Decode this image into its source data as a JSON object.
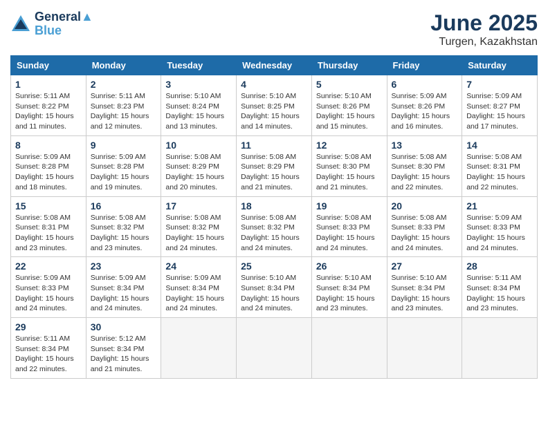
{
  "logo": {
    "line1": "General",
    "line2": "Blue"
  },
  "title": "June 2025",
  "location": "Turgen, Kazakhstan",
  "weekdays": [
    "Sunday",
    "Monday",
    "Tuesday",
    "Wednesday",
    "Thursday",
    "Friday",
    "Saturday"
  ],
  "weeks": [
    [
      {
        "day": 1,
        "sunrise": "5:11 AM",
        "sunset": "8:22 PM",
        "daylight": "15 hours and 11 minutes."
      },
      {
        "day": 2,
        "sunrise": "5:11 AM",
        "sunset": "8:23 PM",
        "daylight": "15 hours and 12 minutes."
      },
      {
        "day": 3,
        "sunrise": "5:10 AM",
        "sunset": "8:24 PM",
        "daylight": "15 hours and 13 minutes."
      },
      {
        "day": 4,
        "sunrise": "5:10 AM",
        "sunset": "8:25 PM",
        "daylight": "15 hours and 14 minutes."
      },
      {
        "day": 5,
        "sunrise": "5:10 AM",
        "sunset": "8:26 PM",
        "daylight": "15 hours and 15 minutes."
      },
      {
        "day": 6,
        "sunrise": "5:09 AM",
        "sunset": "8:26 PM",
        "daylight": "15 hours and 16 minutes."
      },
      {
        "day": 7,
        "sunrise": "5:09 AM",
        "sunset": "8:27 PM",
        "daylight": "15 hours and 17 minutes."
      }
    ],
    [
      {
        "day": 8,
        "sunrise": "5:09 AM",
        "sunset": "8:28 PM",
        "daylight": "15 hours and 18 minutes."
      },
      {
        "day": 9,
        "sunrise": "5:09 AM",
        "sunset": "8:28 PM",
        "daylight": "15 hours and 19 minutes."
      },
      {
        "day": 10,
        "sunrise": "5:08 AM",
        "sunset": "8:29 PM",
        "daylight": "15 hours and 20 minutes."
      },
      {
        "day": 11,
        "sunrise": "5:08 AM",
        "sunset": "8:29 PM",
        "daylight": "15 hours and 21 minutes."
      },
      {
        "day": 12,
        "sunrise": "5:08 AM",
        "sunset": "8:30 PM",
        "daylight": "15 hours and 21 minutes."
      },
      {
        "day": 13,
        "sunrise": "5:08 AM",
        "sunset": "8:30 PM",
        "daylight": "15 hours and 22 minutes."
      },
      {
        "day": 14,
        "sunrise": "5:08 AM",
        "sunset": "8:31 PM",
        "daylight": "15 hours and 22 minutes."
      }
    ],
    [
      {
        "day": 15,
        "sunrise": "5:08 AM",
        "sunset": "8:31 PM",
        "daylight": "15 hours and 23 minutes."
      },
      {
        "day": 16,
        "sunrise": "5:08 AM",
        "sunset": "8:32 PM",
        "daylight": "15 hours and 23 minutes."
      },
      {
        "day": 17,
        "sunrise": "5:08 AM",
        "sunset": "8:32 PM",
        "daylight": "15 hours and 24 minutes."
      },
      {
        "day": 18,
        "sunrise": "5:08 AM",
        "sunset": "8:32 PM",
        "daylight": "15 hours and 24 minutes."
      },
      {
        "day": 19,
        "sunrise": "5:08 AM",
        "sunset": "8:33 PM",
        "daylight": "15 hours and 24 minutes."
      },
      {
        "day": 20,
        "sunrise": "5:08 AM",
        "sunset": "8:33 PM",
        "daylight": "15 hours and 24 minutes."
      },
      {
        "day": 21,
        "sunrise": "5:09 AM",
        "sunset": "8:33 PM",
        "daylight": "15 hours and 24 minutes."
      }
    ],
    [
      {
        "day": 22,
        "sunrise": "5:09 AM",
        "sunset": "8:33 PM",
        "daylight": "15 hours and 24 minutes."
      },
      {
        "day": 23,
        "sunrise": "5:09 AM",
        "sunset": "8:34 PM",
        "daylight": "15 hours and 24 minutes."
      },
      {
        "day": 24,
        "sunrise": "5:09 AM",
        "sunset": "8:34 PM",
        "daylight": "15 hours and 24 minutes."
      },
      {
        "day": 25,
        "sunrise": "5:10 AM",
        "sunset": "8:34 PM",
        "daylight": "15 hours and 24 minutes."
      },
      {
        "day": 26,
        "sunrise": "5:10 AM",
        "sunset": "8:34 PM",
        "daylight": "15 hours and 23 minutes."
      },
      {
        "day": 27,
        "sunrise": "5:10 AM",
        "sunset": "8:34 PM",
        "daylight": "15 hours and 23 minutes."
      },
      {
        "day": 28,
        "sunrise": "5:11 AM",
        "sunset": "8:34 PM",
        "daylight": "15 hours and 23 minutes."
      }
    ],
    [
      {
        "day": 29,
        "sunrise": "5:11 AM",
        "sunset": "8:34 PM",
        "daylight": "15 hours and 22 minutes."
      },
      {
        "day": 30,
        "sunrise": "5:12 AM",
        "sunset": "8:34 PM",
        "daylight": "15 hours and 21 minutes."
      },
      null,
      null,
      null,
      null,
      null
    ]
  ]
}
